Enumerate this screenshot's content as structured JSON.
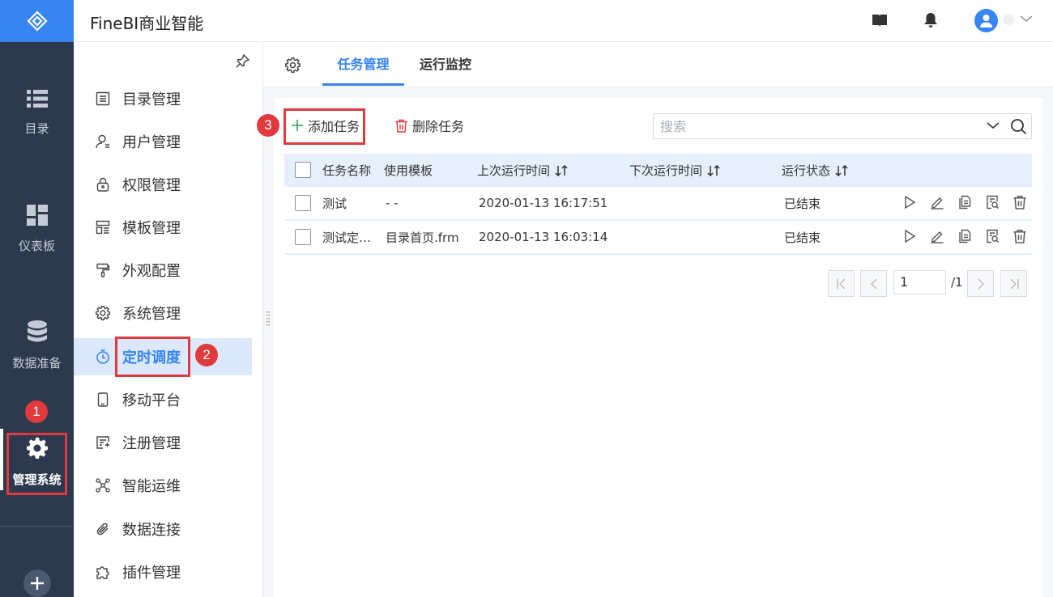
{
  "app": {
    "title": "FineBI商业智能"
  },
  "colors": {
    "accent": "#3685f2",
    "rail": "#2d3a4e",
    "annotation": "#e0393e"
  },
  "rail": {
    "items": [
      {
        "label": "目录",
        "icon": "list-icon"
      },
      {
        "label": "仪表板",
        "icon": "dashboard-icon"
      },
      {
        "label": "数据准备",
        "icon": "database-icon"
      },
      {
        "label": "管理系统",
        "icon": "gear-icon",
        "active": true
      }
    ]
  },
  "menu": {
    "items": [
      {
        "label": "目录管理",
        "icon": "catalog-icon"
      },
      {
        "label": "用户管理",
        "icon": "user-icon"
      },
      {
        "label": "权限管理",
        "icon": "lock-icon"
      },
      {
        "label": "模板管理",
        "icon": "template-icon"
      },
      {
        "label": "外观配置",
        "icon": "brush-icon"
      },
      {
        "label": "系统管理",
        "icon": "gear-icon"
      },
      {
        "label": "定时调度",
        "icon": "timer-icon",
        "active": true
      },
      {
        "label": "移动平台",
        "icon": "mobile-icon"
      },
      {
        "label": "注册管理",
        "icon": "register-icon"
      },
      {
        "label": "智能运维",
        "icon": "ops-icon"
      },
      {
        "label": "数据连接",
        "icon": "paperclip-icon"
      },
      {
        "label": "插件管理",
        "icon": "puzzle-icon"
      }
    ]
  },
  "tabs": [
    {
      "label": "任务管理",
      "active": true
    },
    {
      "label": "运行监控"
    }
  ],
  "toolbar": {
    "add_label": "添加任务",
    "delete_label": "删除任务",
    "search_placeholder": "搜索"
  },
  "table": {
    "headers": [
      "任务名称",
      "使用模板",
      "上次运行时间",
      "下次运行时间",
      "运行状态"
    ],
    "rows": [
      {
        "name": "测试",
        "template": "- -",
        "last_run": "2020-01-13 16:17:51",
        "next_run": "",
        "status": "已结束"
      },
      {
        "name": "测试定…",
        "template": "目录首页.frm",
        "last_run": "2020-01-13 16:03:14",
        "next_run": "",
        "status": "已结束"
      }
    ],
    "row_actions": [
      "play-icon",
      "edit-icon",
      "copy-icon",
      "log-icon",
      "trash-icon"
    ]
  },
  "pagination": {
    "current_page": "1",
    "total_label": "/1"
  },
  "annotations": [
    "1",
    "2",
    "3"
  ]
}
